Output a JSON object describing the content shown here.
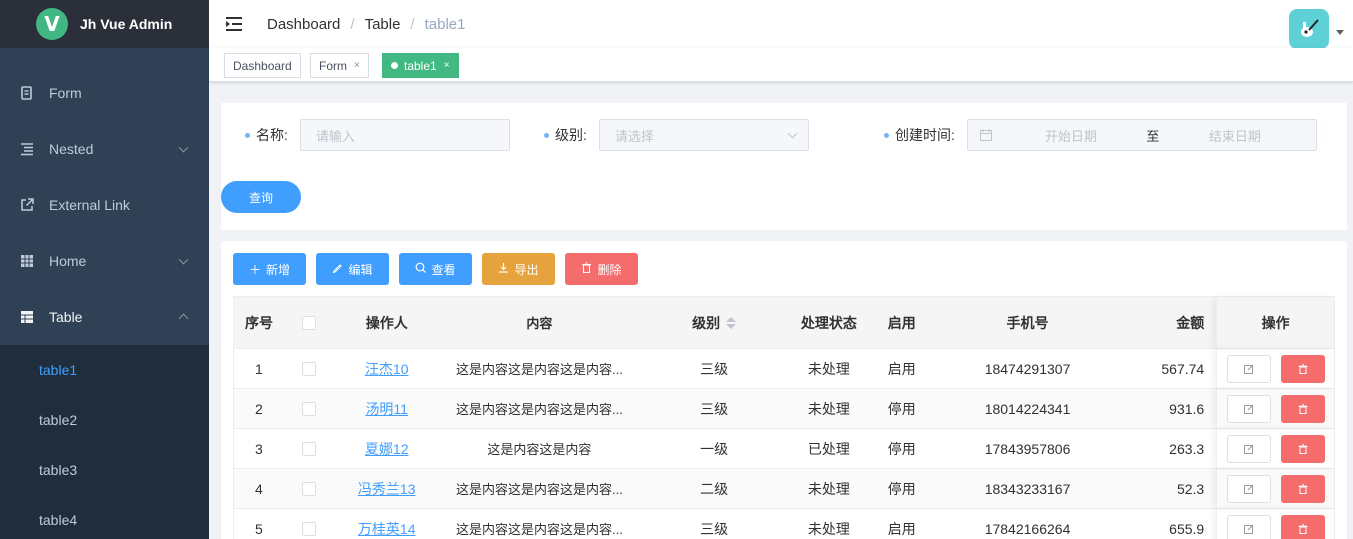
{
  "app": {
    "title": "Jh Vue Admin",
    "logo_letter": "V"
  },
  "sidebar": {
    "items": [
      {
        "label": "Form",
        "icon": "form-icon"
      },
      {
        "label": "Nested",
        "icon": "nested-icon"
      },
      {
        "label": "External Link",
        "icon": "external-link-icon"
      },
      {
        "label": "Home",
        "icon": "grid-icon"
      },
      {
        "label": "Table",
        "icon": "table-icon"
      }
    ],
    "sub_items": [
      {
        "label": "table1",
        "active": true
      },
      {
        "label": "table2"
      },
      {
        "label": "table3"
      },
      {
        "label": "table4"
      }
    ]
  },
  "breadcrumb": [
    "Dashboard",
    "Table",
    "table1"
  ],
  "tags": [
    {
      "label": "Dashboard",
      "closable": false
    },
    {
      "label": "Form",
      "closable": true
    },
    {
      "label": "table1",
      "closable": true,
      "active": true
    }
  ],
  "search": {
    "name_label": "名称:",
    "name_placeholder": "请输入",
    "level_label": "级别:",
    "level_placeholder": "请选择",
    "time_label": "创建时间:",
    "start_placeholder": "开始日期",
    "range_sep": "至",
    "end_placeholder": "结束日期",
    "query_button": "查询"
  },
  "toolbar": {
    "add": "新增",
    "edit": "编辑",
    "view": "查看",
    "export": "导出",
    "delete": "删除"
  },
  "colors": {
    "primary": "#409eff",
    "warning": "#e6a23c",
    "danger": "#f56c6c",
    "sidebar": "#304156",
    "tag_active": "#42b983"
  },
  "table": {
    "headers": {
      "idx": "序号",
      "operator": "操作人",
      "content": "内容",
      "level": "级别",
      "status": "处理状态",
      "enable": "启用",
      "phone": "手机号",
      "amount": "金额",
      "action": "操作"
    },
    "rows": [
      {
        "idx": "1",
        "operator": "汪杰10",
        "content": "这是内容这是内容这是内容...",
        "level": "三级",
        "status": "未处理",
        "enable": "启用",
        "phone": "18474291307",
        "amount": "567.74"
      },
      {
        "idx": "2",
        "operator": "汤明11",
        "content": "这是内容这是内容这是内容...",
        "level": "三级",
        "status": "未处理",
        "enable": "停用",
        "phone": "18014224341",
        "amount": "931.6"
      },
      {
        "idx": "3",
        "operator": "夏娜12",
        "content": "这是内容这是内容",
        "level": "一级",
        "status": "已处理",
        "enable": "停用",
        "phone": "17843957806",
        "amount": "263.3"
      },
      {
        "idx": "4",
        "operator": "冯秀兰13",
        "content": "这是内容这是内容这是内容...",
        "level": "二级",
        "status": "未处理",
        "enable": "停用",
        "phone": "18343233167",
        "amount": "52.3"
      },
      {
        "idx": "5",
        "operator": "万桂英14",
        "content": "这是内容这是内容这是内容...",
        "level": "三级",
        "status": "未处理",
        "enable": "启用",
        "phone": "17842166264",
        "amount": "655.9"
      }
    ]
  }
}
